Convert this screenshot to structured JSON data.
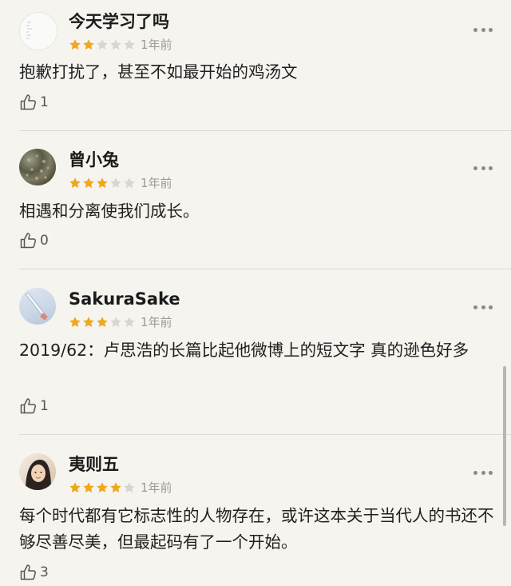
{
  "accent_star_color": "#f0a81c",
  "empty_star_color": "#d9d6cf",
  "reviews": [
    {
      "username": "今天学习了吗",
      "rating": 2,
      "time": "1年前",
      "content": "抱歉打扰了，甚至不如最开始的鸡汤文",
      "likes": "1",
      "avatar_icon": "blank-sketch-avatar"
    },
    {
      "username": "曾小兔",
      "rating": 3,
      "time": "1年前",
      "content": "相遇和分离使我们成长。",
      "likes": "0",
      "avatar_icon": "moss-texture-avatar"
    },
    {
      "username": "SakuraSake",
      "rating": 3,
      "time": "1年前",
      "content": "2019/62：卢思浩的长篇比起他微博上的短文字 真的逊色好多",
      "likes": "1",
      "avatar_icon": "bottle-sky-avatar"
    },
    {
      "username": "夷则五",
      "rating": 4,
      "time": "1年前",
      "content": "每个时代都有它标志性的人物存在，或许这本关于当代人的书还不够尽善尽美，但最起码有了一个开始。",
      "likes": "3",
      "avatar_icon": "portrait-girl-avatar"
    }
  ]
}
